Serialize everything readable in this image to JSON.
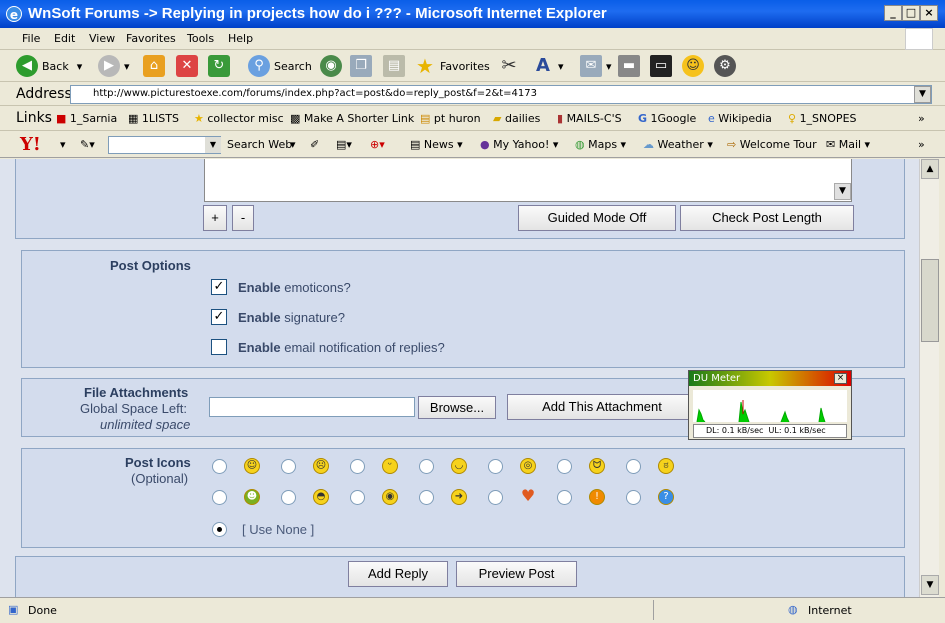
{
  "window": {
    "title": "WnSoft Forums -> Replying in projects how do i ??? - Microsoft Internet Explorer"
  },
  "menu": [
    "File",
    "Edit",
    "View",
    "Favorites",
    "Tools",
    "Help"
  ],
  "toolbar": {
    "back": "Back",
    "search": "Search",
    "favorites": "Favorites"
  },
  "address": {
    "label": "Address",
    "url": "http://www.picturestoexe.com/forums/index.php?act=post&do=reply_post&f=2&t=4173"
  },
  "links": {
    "label": "Links",
    "items": [
      "1_Sarnia",
      "1LISTS",
      "collector misc",
      "Make A Shorter Link",
      "pt huron",
      "dailies",
      "MAILS-C'S",
      "1Google",
      "Wikipedia",
      "1_SNOPES"
    ]
  },
  "yahoo": {
    "search_btn": "Search Web",
    "items": [
      "News",
      "My Yahoo!",
      "Maps",
      "Weather",
      "Welcome Tour",
      "Mail"
    ]
  },
  "editor": {
    "plus": "+",
    "minus": "-",
    "guided": "Guided Mode Off",
    "check": "Check Post Length"
  },
  "post_options": {
    "title": "Post Options",
    "items": [
      {
        "bold": "Enable",
        "text": "emoticons?",
        "checked": true
      },
      {
        "bold": "Enable",
        "text": "signature?",
        "checked": true
      },
      {
        "bold": "Enable",
        "text": "email notification of replies?",
        "checked": false
      }
    ]
  },
  "attachments": {
    "title": "File Attachments",
    "space_label": "Global Space Left:",
    "space_value": "unlimited space",
    "browse": "Browse...",
    "add": "Add This Attachment"
  },
  "post_icons": {
    "title": "Post Icons",
    "subtitle": "(Optional)",
    "use_none": "[ Use None ]"
  },
  "actions": {
    "add_reply": "Add Reply",
    "preview": "Preview Post"
  },
  "dumeter": {
    "title": "DU Meter",
    "dl": "DL: 0.1 kB/sec",
    "ul": "UL: 0.1 kB/sec"
  },
  "status": {
    "left": "Done",
    "zone": "Internet"
  }
}
